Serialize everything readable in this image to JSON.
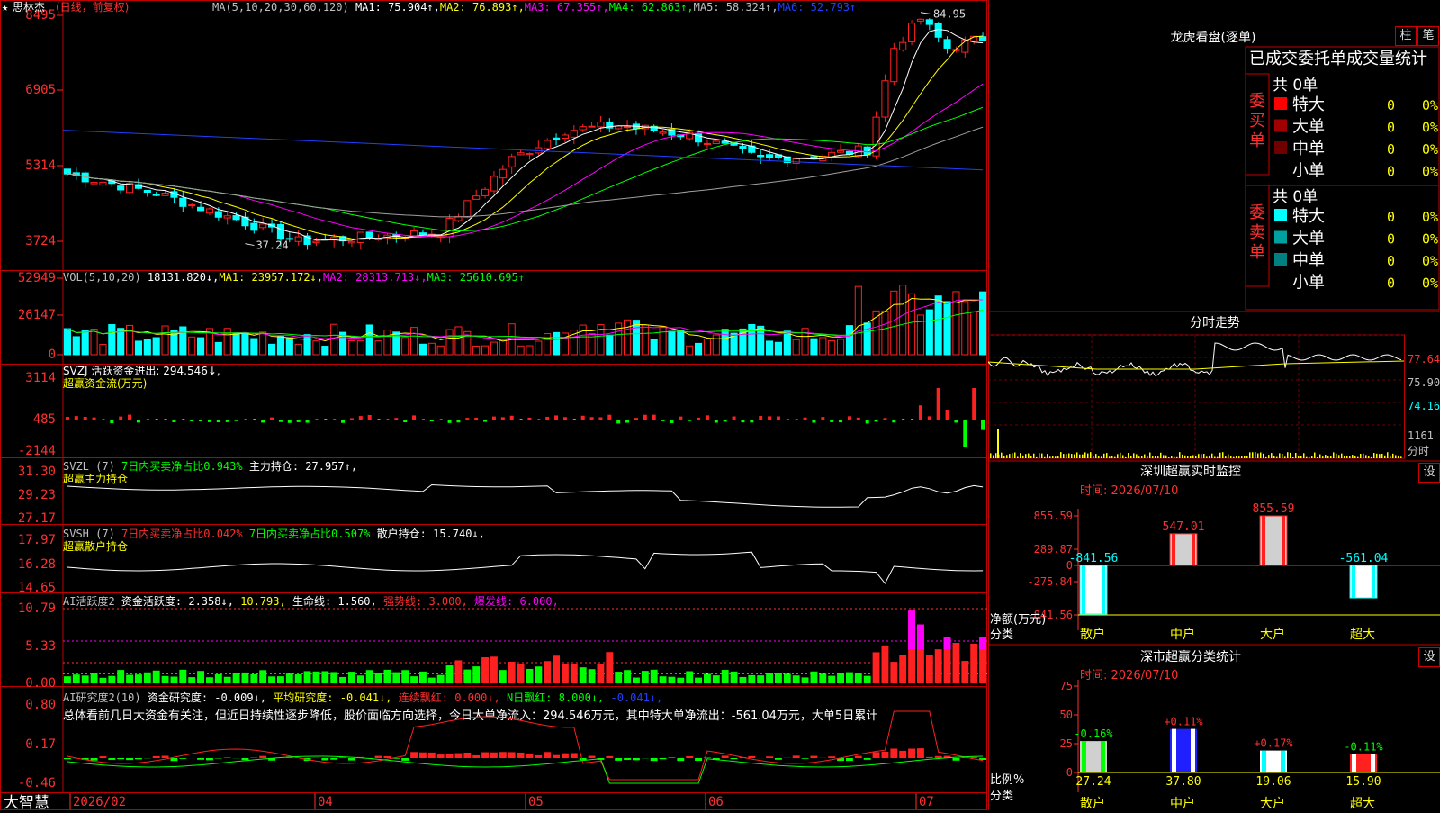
{
  "stock": {
    "star": "★",
    "name": "思林杰",
    "mode": "(日线，前复权)"
  },
  "ma_bar": {
    "label": "MA(5,10,20,30,60,120)",
    "items": [
      {
        "text": "MA1: 75.904↑,",
        "color": "#ffffff"
      },
      {
        "text": "MA2: 76.893↑,",
        "color": "#ffff00"
      },
      {
        "text": "MA3: 67.355↑,",
        "color": "#ff00ff"
      },
      {
        "text": "MA4: 62.863↑,",
        "color": "#00ff00"
      },
      {
        "text": "MA5: 58.324↑,",
        "color": "#c0c0c0"
      },
      {
        "text": "MA6: 52.793↑",
        "color": "#2040ff"
      }
    ]
  },
  "vol_bar": {
    "label": "VOL(5,10,20)",
    "items": [
      {
        "text": "18131.820↓,",
        "color": "#ffffff"
      },
      {
        "text": "MA1: 23957.172↓,",
        "color": "#ffff00"
      },
      {
        "text": "MA2: 28313.713↓,",
        "color": "#ff00ff"
      },
      {
        "text": "MA3: 25610.695↑",
        "color": "#00ff00"
      }
    ]
  },
  "svzj_bar": {
    "line1": "SVZJ  活跃资金进出: 294.546↓,",
    "line2": "超赢资金流(万元)"
  },
  "svzl_bar": {
    "items": [
      {
        "text": "SVZL (7) ",
        "color": "#c0c0c0"
      },
      {
        "text": "7日内买卖净占比0.943%",
        "color": "#00ff00"
      },
      {
        "text": " 主力持仓: 27.957↑,",
        "color": "#ffffff"
      }
    ],
    "line2": "超赢主力持仓"
  },
  "svsh_bar": {
    "items": [
      {
        "text": "SVSH (7) ",
        "color": "#c0c0c0"
      },
      {
        "text": "7日内买卖净占比0.042%",
        "color": "#ff3030"
      },
      {
        "text": " 7日内买卖净占比0.507%",
        "color": "#00ff00"
      },
      {
        "text": " 散户持仓: 15.740↓,",
        "color": "#ffffff"
      }
    ],
    "line2": "超赢散户持仓"
  },
  "ai_bar": {
    "items": [
      {
        "text": "AI活跃度2 ",
        "color": "#c0c0c0"
      },
      {
        "text": "资金活跃度: 2.358↓,",
        "color": "#ffffff"
      },
      {
        "text": " 10.793,",
        "color": "#ffff00"
      },
      {
        "text": " 生命线: 1.560,",
        "color": "#ffffff"
      },
      {
        "text": " 强势线: 3.000,",
        "color": "#ff3030"
      },
      {
        "text": " 爆发线: 6.000,",
        "color": "#ff00ff"
      }
    ]
  },
  "air_bar": {
    "items": [
      {
        "text": "AI研究度2(10) ",
        "color": "#c0c0c0"
      },
      {
        "text": "资金研究度: -0.009↓,",
        "color": "#ffffff"
      },
      {
        "text": " 平均研究度: -0.041↓,",
        "color": "#ffff00"
      },
      {
        "text": " 连续飘红: 0.000↓,",
        "color": "#ff3030"
      },
      {
        "text": " N日飘红: 8.000↓,",
        "color": "#00ff00"
      },
      {
        "text": " -0.041↓,",
        "color": "#2040ff"
      }
    ],
    "summary": "总体看前几日大资金有关注，但近日持续性逐步降低，股价面临方向选择，今日大单净流入：294.546万元，其中特大单净流出：-561.04万元，大单5日累计"
  },
  "app_name": "大智慧",
  "date_axis": [
    "2026/02",
    "04",
    "05",
    "06",
    "07"
  ],
  "right": {
    "title": "龙虎看盘(逐单)",
    "tab_bar": "柱",
    "tab_pen": "笔",
    "stats_header": "已成交委托单成交量统计",
    "buy": {
      "side_label": "委买单",
      "total": "共 0单",
      "rows": [
        {
          "label": "特大",
          "count": "0",
          "pct": "0%",
          "color": "#ff0000"
        },
        {
          "label": "大单",
          "count": "0",
          "pct": "0%",
          "color": "#a00000"
        },
        {
          "label": "中单",
          "count": "0",
          "pct": "0%",
          "color": "#700000"
        },
        {
          "label": "小单",
          "count": "0",
          "pct": "0%",
          "color": "#000000"
        }
      ]
    },
    "sell": {
      "side_label": "委卖单",
      "total": "共 0单",
      "rows": [
        {
          "label": "特大",
          "count": "0",
          "pct": "0%",
          "color": "#00ffff"
        },
        {
          "label": "大单",
          "count": "0",
          "pct": "0%",
          "color": "#00a0a0"
        },
        {
          "label": "中单",
          "count": "0",
          "pct": "0%",
          "color": "#008080"
        },
        {
          "label": "小单",
          "count": "0",
          "pct": "0%",
          "color": "#000000"
        }
      ]
    },
    "minute_title": "分时走势",
    "minute_prices": [
      "77.64",
      "75.90",
      "74.16"
    ],
    "minute_vol": "1161",
    "minute_vol_label": "分时",
    "sz_title": "深圳超赢实时监控",
    "sz_time": "时间: 2026/07/10",
    "sz_axis": [
      "855.59",
      "289.87",
      "0",
      "-275.84",
      "-841.56"
    ],
    "net_label": "净额(万元)",
    "cat_label": "分类",
    "settings": "设",
    "class_title": "深市超赢分类统计",
    "class_time": "时间: 2026/07/10",
    "class_axis": [
      "75",
      "50",
      "25",
      "0"
    ],
    "ratio_label": "比例%",
    "categories": [
      "散户",
      "中户",
      "大户",
      "超大"
    ]
  },
  "chart_data": [
    {
      "type": "candlestick",
      "name": "price",
      "y_ticks": [
        8495,
        6905,
        5314,
        3724
      ],
      "annotations": [
        "84.95",
        "37.24"
      ]
    },
    {
      "type": "bar",
      "name": "volume",
      "y_ticks": [
        52949,
        26147,
        0
      ]
    },
    {
      "type": "bar",
      "name": "svzj",
      "y_ticks": [
        3114,
        485,
        -2144
      ]
    },
    {
      "type": "line",
      "name": "svzl",
      "y_ticks": [
        31.3,
        29.23,
        27.17
      ]
    },
    {
      "type": "line",
      "name": "svsh",
      "y_ticks": [
        17.97,
        16.28,
        14.65
      ]
    },
    {
      "type": "bar",
      "name": "ai_activity",
      "y_ticks": [
        10.79,
        5.33,
        0.0
      ]
    },
    {
      "type": "bar",
      "name": "ai_research",
      "y_ticks": [
        0.8,
        0.17,
        -0.46
      ]
    },
    {
      "type": "bar",
      "name": "shenzhen_monitor",
      "categories": [
        "散户",
        "中户",
        "大户",
        "超大"
      ],
      "values": [
        -841.56,
        547.01,
        855.59,
        -561.04
      ],
      "ylim": [
        -841.56,
        855.59
      ]
    },
    {
      "type": "bar",
      "name": "shenzhen_class",
      "categories": [
        "散户",
        "中户",
        "大户",
        "超大"
      ],
      "values": [
        27.24,
        37.8,
        19.06,
        15.9
      ],
      "changes": [
        "-0.16%",
        "+0.11%",
        "+0.17%",
        "-0.11%"
      ],
      "ylim": [
        0,
        75
      ]
    }
  ]
}
